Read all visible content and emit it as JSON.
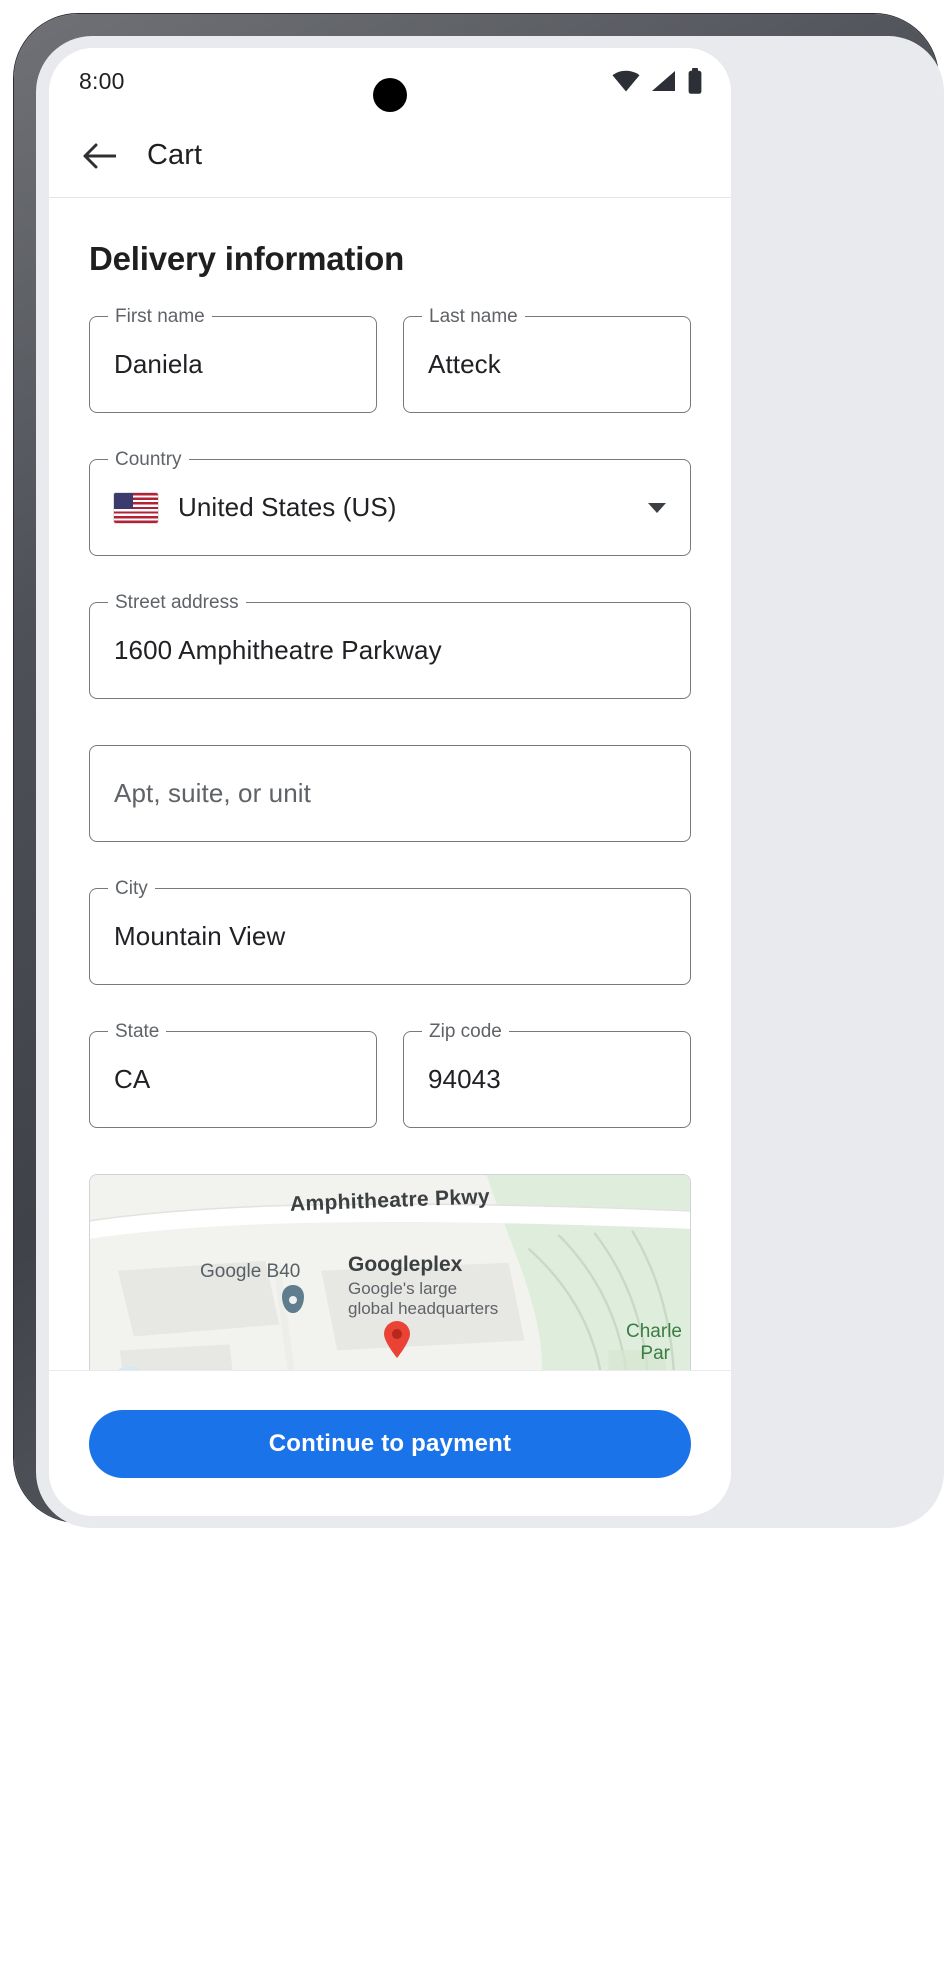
{
  "status_bar": {
    "time": "8:00",
    "icons": [
      "wifi-icon",
      "cellular-signal-icon",
      "battery-icon"
    ]
  },
  "app_bar": {
    "back_icon": "arrow-back-icon",
    "title": "Cart"
  },
  "main": {
    "section_heading": "Delivery information",
    "fields": {
      "first_name": {
        "label": "First name",
        "value": "Daniela"
      },
      "last_name": {
        "label": "Last name",
        "value": "Atteck"
      },
      "country": {
        "label": "Country",
        "value": "United States (US)",
        "flag": "us-flag-icon"
      },
      "street_address": {
        "label": "Street address",
        "value": "1600 Amphitheatre Parkway"
      },
      "apt": {
        "label": "",
        "value": "",
        "placeholder": "Apt, suite, or unit"
      },
      "city": {
        "label": "City",
        "value": "Mountain View"
      },
      "state": {
        "label": "State",
        "value": "CA"
      },
      "zip": {
        "label": "Zip code",
        "value": "94043"
      }
    },
    "map": {
      "road_label": "Amphitheatre Pkwy",
      "building_label": "Google B40",
      "place_name": "Googleplex",
      "place_desc_line1": "Google's large",
      "place_desc_line2": "global headquarters",
      "park_label_line1": "Charle",
      "park_label_line2": "Par"
    }
  },
  "bottom": {
    "continue_label": "Continue to payment"
  },
  "colors": {
    "accent": "#1a73e8",
    "text_primary": "#1f1f1f",
    "text_secondary": "#5f6368",
    "field_border": "#76797e",
    "map_pin_red": "#ea4335"
  }
}
